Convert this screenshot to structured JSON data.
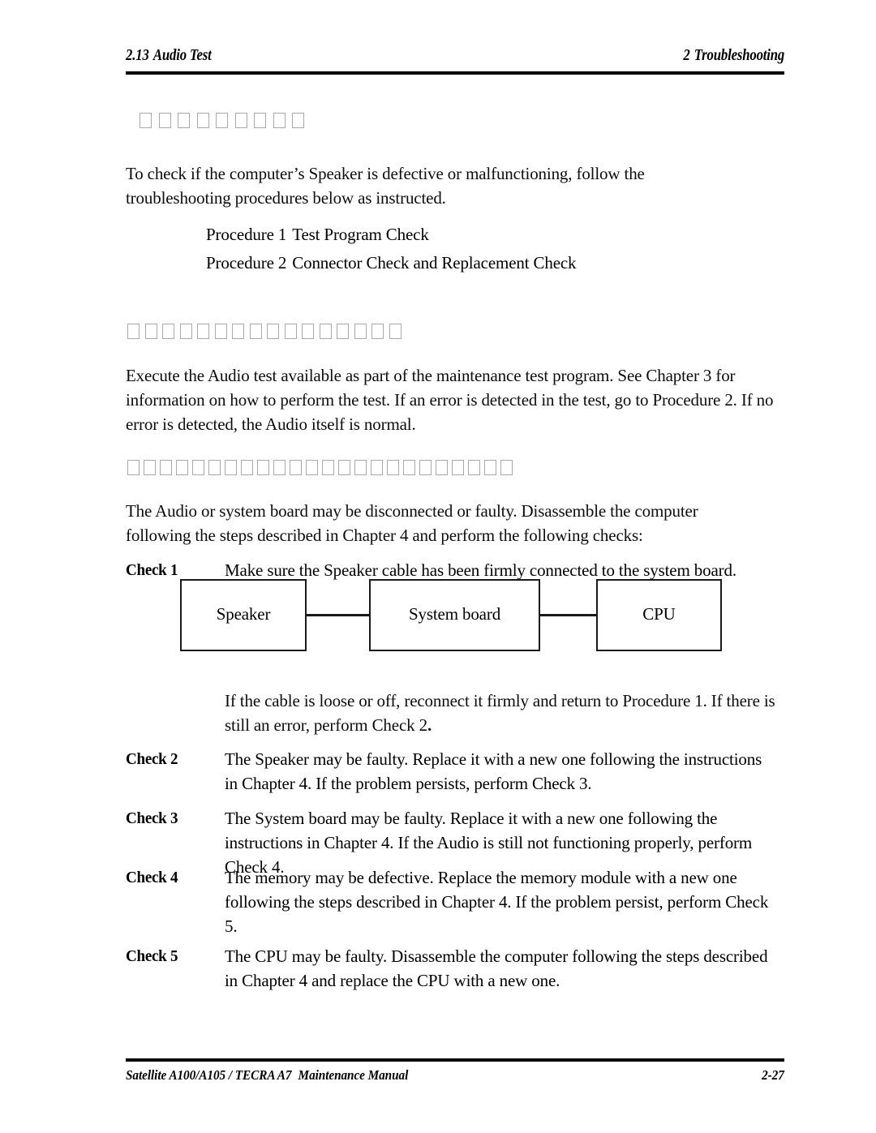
{
  "header": {
    "section_number": "2.13",
    "section_title": "Audio Test",
    "chapter_number": "2",
    "chapter_title": "Troubleshooting"
  },
  "headings": [
    {
      "name": "audio-test-heading",
      "glyph_count": 9,
      "note": "missing-glyph boxes"
    },
    {
      "name": "procedure-1-heading",
      "glyph_count": 16,
      "note": "missing-glyph boxes"
    },
    {
      "name": "procedure-2-heading",
      "glyph_count": 24,
      "note": "missing-glyph boxes"
    }
  ],
  "intro": {
    "paragraph": "To check if the computer’s Speaker is defective or malfunctioning, follow the troubleshooting procedures below as instructed."
  },
  "procedures": [
    {
      "label": "Procedure 1",
      "title": "Test Program Check"
    },
    {
      "label": "Procedure 2",
      "title": "Connector Check and Replacement Check"
    }
  ],
  "procedure_1": {
    "body": "Execute the Audio test available as part of the maintenance test program.  See Chapter 3 for information on how to perform the test. If an error is detected in the test, go to Procedure 2.  If no error is detected, the Audio itself is normal."
  },
  "procedure_2": {
    "body": "The Audio or system board may be disconnected or faulty.  Disassemble the computer following the steps described in Chapter 4 and perform the following checks:"
  },
  "checks": [
    {
      "label": "Check 1",
      "text": "Make sure the Speaker cable has been firmly connected to the system board."
    },
    {
      "label": "Check 2",
      "text": "The Speaker may be faulty.  Replace it with a new one following the instructions in Chapter 4.  If the problem persists, perform Check 3."
    },
    {
      "label": "Check 3",
      "text": "The System board may be faulty.  Replace it with a new one following the instructions in Chapter 4.  If the Audio is still not functioning properly, perform Check 4."
    },
    {
      "label": "Check 4",
      "text": "The memory may be defective. Replace the memory module with a new one following the steps described in Chapter 4. If the problem persist, perform Check 5."
    },
    {
      "label": "Check 5",
      "text": "The CPU may be faulty. Disassemble the computer following the steps described in Chapter 4 and replace the CPU with a new one."
    }
  ],
  "check_1_followup": {
    "text_before": "If the cable is loose or off, reconnect it firmly and return to Procedure 1.  If there is still an error, perform Check 2",
    "text_after": "."
  },
  "diagram": {
    "boxes": [
      {
        "id": "speaker",
        "label": "Speaker"
      },
      {
        "id": "system-board",
        "label": "System board"
      },
      {
        "id": "cpu",
        "label": "CPU"
      }
    ]
  },
  "footer": {
    "manual_models": "Satellite A100/A105 / TECRA A7",
    "manual_title": "Maintenance Manual",
    "page_number": "2-27"
  },
  "colors": {
    "text": "#000000",
    "rule": "#000000",
    "box_border": "#1a1a1a",
    "tofu_border": "#a9a9a9"
  }
}
